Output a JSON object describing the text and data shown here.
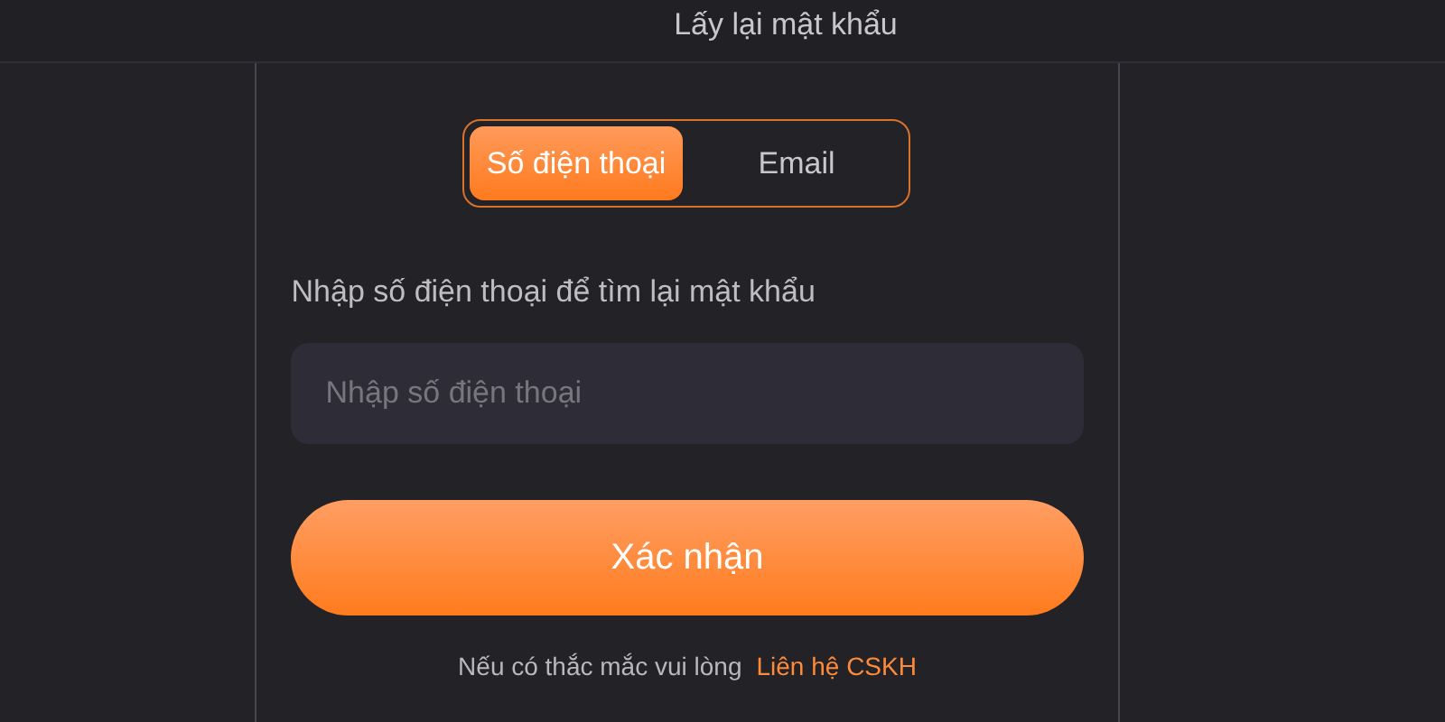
{
  "header": {
    "title": "Lấy lại mật khẩu"
  },
  "tabs": [
    {
      "label": "Số điện thoại",
      "selected": true
    },
    {
      "label": "Email",
      "selected": false
    }
  ],
  "form": {
    "label": "Nhập số điện thoại để tìm lại mật khẩu",
    "placeholder": "Nhập số điện thoại",
    "submit": "Xác nhận"
  },
  "footer": {
    "text": "Nếu có thắc mắc vui lòng",
    "link": "Liên hệ CSKH"
  }
}
